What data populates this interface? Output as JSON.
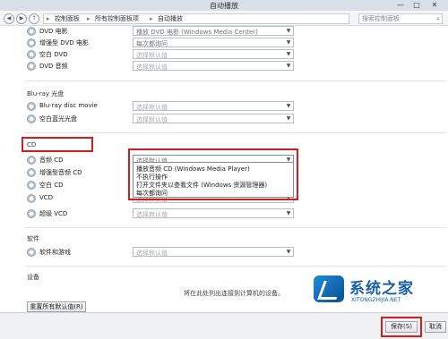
{
  "window": {
    "title": "自动播放",
    "minimize": "—",
    "maximize": "□",
    "close": "✕"
  },
  "address": {
    "back": "◀",
    "forward": "▶",
    "up": "↑",
    "crumbs": [
      "控制面板",
      "所有控制面板项",
      "自动播放"
    ],
    "separator": "▸",
    "search_placeholder": "搜索控制面板",
    "search_icon": "⌕"
  },
  "rows_top": [
    {
      "label": "DVD 电影",
      "value": "播放 DVD 电影 (Windows Media Center)"
    },
    {
      "label": "增强型 DVD 电影",
      "value": "每次都询问"
    },
    {
      "label": "空白 DVD",
      "value": "选择默认值"
    },
    {
      "label": "DVD 音频",
      "value": "选择默认值"
    }
  ],
  "bluray": {
    "title": "Blu-ray 光盘",
    "rows": [
      {
        "label": "Blu-ray disc movie",
        "value": "选择默认值"
      },
      {
        "label": "空白蓝光光盘",
        "value": "选择默认值"
      }
    ]
  },
  "cd": {
    "title": "CD",
    "rows": [
      {
        "label": "音频 CD",
        "value": "选择默认值"
      },
      {
        "label": "增强型音频 CD",
        "value": ""
      },
      {
        "label": "空白 CD",
        "value": ""
      },
      {
        "label": "VCD",
        "value": "选择默认值"
      },
      {
        "label": "超级 VCD",
        "value": "选择默认值"
      }
    ],
    "dropdown_options": [
      "播放音频 CD (Windows Media Player)",
      "不执行操作",
      "打开文件夹以查看文件 (Windows 资源管理器)",
      "每次都询问"
    ]
  },
  "software": {
    "title": "软件",
    "rows": [
      {
        "label": "软件和游戏",
        "value": "选择默认值"
      }
    ]
  },
  "devices": {
    "title": "设备",
    "hint": "将在此处列出连接到计算机的设备。"
  },
  "buttons": {
    "reset": "重置所有默认值(R)",
    "save": "保存(S)",
    "cancel": "取消"
  },
  "watermark": {
    "name": "系统之家",
    "url": "XITONGZHIJIA.NET"
  },
  "colors": {
    "highlight": "#d11d1d",
    "brand": "#1b5fa3"
  }
}
